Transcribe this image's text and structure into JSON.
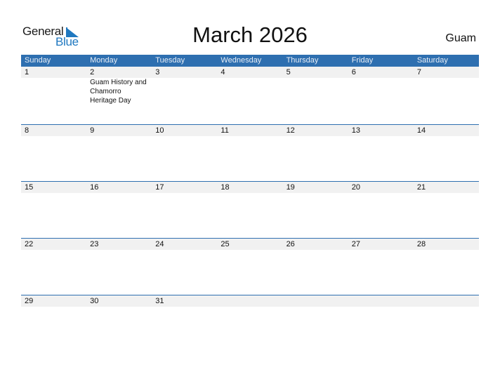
{
  "logo": {
    "general": "General",
    "blue": "Blue"
  },
  "title": "March 2026",
  "region": "Guam",
  "weekdays": [
    "Sunday",
    "Monday",
    "Tuesday",
    "Wednesday",
    "Thursday",
    "Friday",
    "Saturday"
  ],
  "weeks": [
    {
      "days": [
        "1",
        "2",
        "3",
        "4",
        "5",
        "6",
        "7"
      ],
      "events": [
        "",
        "Guam History and Chamorro Heritage Day",
        "",
        "",
        "",
        "",
        ""
      ]
    },
    {
      "days": [
        "8",
        "9",
        "10",
        "11",
        "12",
        "13",
        "14"
      ],
      "events": [
        "",
        "",
        "",
        "",
        "",
        "",
        ""
      ]
    },
    {
      "days": [
        "15",
        "16",
        "17",
        "18",
        "19",
        "20",
        "21"
      ],
      "events": [
        "",
        "",
        "",
        "",
        "",
        "",
        ""
      ]
    },
    {
      "days": [
        "22",
        "23",
        "24",
        "25",
        "26",
        "27",
        "28"
      ],
      "events": [
        "",
        "",
        "",
        "",
        "",
        "",
        ""
      ]
    },
    {
      "days": [
        "29",
        "30",
        "31",
        "",
        "",
        "",
        ""
      ],
      "events": [
        "",
        "",
        "",
        "",
        "",
        "",
        ""
      ]
    }
  ],
  "colors": {
    "header_bg": "#2e6fb0",
    "day_bar_bg": "#f1f1f1",
    "brand_blue": "#1f78c0"
  }
}
